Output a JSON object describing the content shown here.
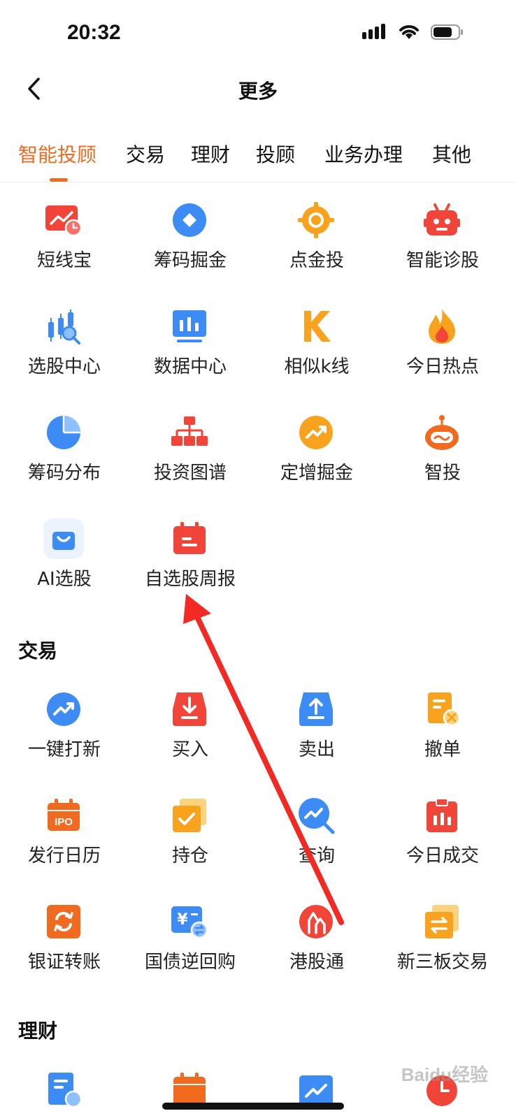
{
  "status": {
    "time": "20:32"
  },
  "nav": {
    "title": "更多"
  },
  "tabs": [
    {
      "label": "智能投顾"
    },
    {
      "label": "交易"
    },
    {
      "label": "理财"
    },
    {
      "label": "投顾"
    },
    {
      "label": "业务办理"
    },
    {
      "label": "其他"
    }
  ],
  "zhineng": {
    "items": [
      {
        "label": "短线宝",
        "icon": "chart-clock-icon"
      },
      {
        "label": "筹码掘金",
        "icon": "diamond-circle-icon"
      },
      {
        "label": "点金投",
        "icon": "target-icon"
      },
      {
        "label": "智能诊股",
        "icon": "robot-icon"
      },
      {
        "label": "选股中心",
        "icon": "candlestick-search-icon"
      },
      {
        "label": "数据中心",
        "icon": "monitor-bars-icon"
      },
      {
        "label": "相似k线",
        "icon": "letter-k-icon"
      },
      {
        "label": "今日热点",
        "icon": "flame-icon"
      },
      {
        "label": "筹码分布",
        "icon": "pie-chart-icon"
      },
      {
        "label": "投资图谱",
        "icon": "org-chart-icon"
      },
      {
        "label": "定增掘金",
        "icon": "trend-up-circle-icon"
      },
      {
        "label": "智投",
        "icon": "robot-face-icon"
      },
      {
        "label": "AI选股",
        "icon": "shopping-bag-icon"
      },
      {
        "label": "自选股周报",
        "icon": "calendar-icon"
      }
    ]
  },
  "jiaoyi": {
    "title": "交易",
    "items": [
      {
        "label": "一键打新",
        "icon": "trend-up-circle-icon"
      },
      {
        "label": "买入",
        "icon": "download-tray-icon"
      },
      {
        "label": "卖出",
        "icon": "upload-tray-icon"
      },
      {
        "label": "撤单",
        "icon": "document-cancel-icon"
      },
      {
        "label": "发行日历",
        "icon": "ipo-calendar-icon",
        "badge": "IPO"
      },
      {
        "label": "持仓",
        "icon": "checkbox-stack-icon"
      },
      {
        "label": "查询",
        "icon": "search-trend-icon"
      },
      {
        "label": "今日成交",
        "icon": "calendar-bars-icon"
      },
      {
        "label": "银证转账",
        "icon": "exchange-icon"
      },
      {
        "label": "国债逆回购",
        "icon": "yuan-card-icon",
        "badge": "¥"
      },
      {
        "label": "港股通",
        "icon": "bridge-icon"
      },
      {
        "label": "新三板交易",
        "icon": "transfer-stack-icon"
      }
    ]
  },
  "licai": {
    "title": "理财"
  },
  "watermark": "Baidu经验",
  "colors": {
    "accent": "#f06a20",
    "blue": "#3d8bf5",
    "red": "#f2453a",
    "orange": "#f8a21d"
  }
}
